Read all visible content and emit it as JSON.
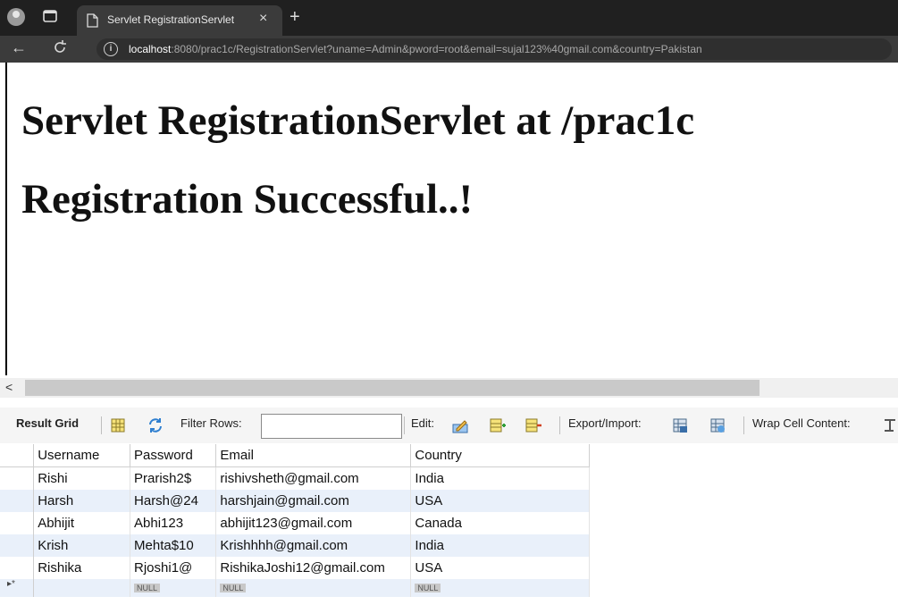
{
  "browser": {
    "tab_title": "Servlet RegistrationServlet",
    "tab_close": "×",
    "new_tab": "+",
    "back": "←",
    "url_host": "localhost",
    "url_rest": ":8080/prac1c/RegistrationServlet?uname=Admin&pword=root&email=sujal123%40gmail.com&country=Pakistan"
  },
  "page": {
    "heading1": "Servlet RegistrationServlet at /prac1c",
    "heading2": "Registration Successful..!"
  },
  "scroll": {
    "left_arrow": "<"
  },
  "toolbar": {
    "result_grid": "Result Grid",
    "filter_rows": "Filter Rows:",
    "filter_value": "",
    "edit": "Edit:",
    "export_import": "Export/Import:",
    "wrap_cell": "Wrap Cell Content:"
  },
  "grid": {
    "columns": [
      "Username",
      "Password",
      "Email",
      "Country"
    ],
    "rows": [
      [
        "Rishi",
        "Prarish2$",
        "rishivsheth@gmail.com",
        "India"
      ],
      [
        "Harsh",
        "Harsh@24",
        "harshjain@gmail.com",
        "USA"
      ],
      [
        "Abhijit",
        "Abhi123",
        "abhijit123@gmail.com",
        "Canada"
      ],
      [
        "Krish",
        "Mehta$10",
        "Krishhhh@gmail.com",
        "India"
      ],
      [
        "Rishika",
        "Rjoshi1@",
        "RishikaJoshi12@gmail.com",
        "USA"
      ]
    ],
    "null_label": "NULL",
    "new_row_marker": "▸*"
  }
}
